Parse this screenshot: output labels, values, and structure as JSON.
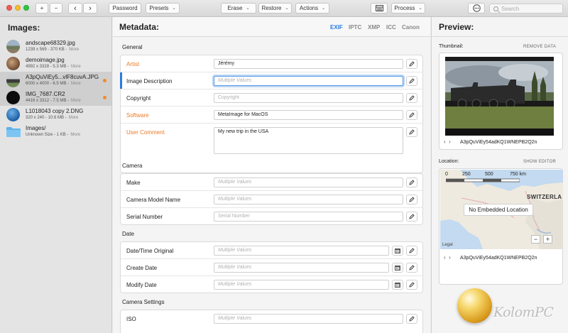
{
  "toolbar": {
    "password_label": "Password",
    "presets_label": "Presets",
    "erase_label": "Erase",
    "restore_label": "Restore",
    "actions_label": "Actions",
    "process_label": "Process",
    "search_placeholder": "Search",
    "plus_label": "+",
    "minus_label": "−",
    "back_label": "‹",
    "forward_label": "›"
  },
  "images_panel": {
    "title": "Images:",
    "items": [
      {
        "name": "andscape68329.jpg",
        "meta": "1239 x 569 - 370 KB -",
        "more": "More",
        "selected": false,
        "modified": false
      },
      {
        "name": "demoimage.jpg",
        "meta": "4992 x 3328 - 5.3 MB -",
        "more": "More",
        "selected": false,
        "modified": false
      },
      {
        "name": "A3pQuViEy5...vlF8cuvA.JPG",
        "meta": "6000 x 4000 - 6.5 MB -",
        "more": "More",
        "selected": true,
        "modified": true
      },
      {
        "name": "IMG_7687.CR2",
        "meta": "4416 x 3312 - 7.5 MB -",
        "more": "More",
        "selected": true,
        "modified": true
      },
      {
        "name": "L1018043 copy 2.DNG",
        "meta": "320 x 240 - 10.6 MB -",
        "more": "More",
        "selected": false,
        "modified": false
      },
      {
        "name": "Images/",
        "meta": "Unknown Size - 1 KB -",
        "more": "More",
        "selected": false,
        "modified": false
      }
    ]
  },
  "metadata_panel": {
    "title": "Metadata:",
    "tabs": [
      "EXIF",
      "IPTC",
      "XMP",
      "ICC",
      "Canon"
    ],
    "active_tab": "EXIF",
    "sections": {
      "general": {
        "label": "General",
        "artist": {
          "label": "Artist",
          "value": "Jérémy"
        },
        "image_description": {
          "label": "Image Description",
          "placeholder": "Multiple Values"
        },
        "copyright": {
          "label": "Copyright",
          "placeholder": "Copyright"
        },
        "software": {
          "label": "Software",
          "value": "MetaImage for MacOS"
        },
        "user_comment": {
          "label": "User Comment",
          "value": "My new trip in the USA"
        }
      },
      "camera": {
        "label": "Camera",
        "make": {
          "label": "Make",
          "placeholder": "Multiple Values"
        },
        "model": {
          "label": "Camera Model Name",
          "placeholder": "Multiple Values"
        },
        "serial": {
          "label": "Serial Number",
          "placeholder": "Serial Number"
        }
      },
      "date": {
        "label": "Date",
        "original": {
          "label": "Date/Time Original",
          "placeholder": "Multiple Values"
        },
        "create": {
          "label": "Create Date",
          "placeholder": "Multiple Values"
        },
        "modify": {
          "label": "Modify Date",
          "placeholder": "Multiple Values"
        }
      },
      "camera_settings": {
        "label": "Camera Settings",
        "iso": {
          "label": "ISO",
          "placeholder": "Multiple Values"
        }
      }
    }
  },
  "preview_panel": {
    "title": "Preview:",
    "thumbnail_label": "Thumbnail:",
    "remove_data_label": "REMOVE DATA",
    "thumbnail_caption": "A3pQuViEy54adKQ1WNEPB2Q2n",
    "location_label": "Location:",
    "show_editor_label": "SHOW EDITOR",
    "map_scale": [
      "0",
      "250",
      "500",
      "750 km"
    ],
    "map_country": "SWITZERLA",
    "no_embedded_location": "No Embedded Location",
    "map_legal": "Legal",
    "location_caption": "A3pQuViEy54adKQ1WNEPB2Q2n"
  },
  "watermark": {
    "text": "KolomPC"
  },
  "colors": {
    "accent_blue": "#2a7be0",
    "modified_orange": "#f08a2c",
    "label_orange": "#e9792a"
  }
}
